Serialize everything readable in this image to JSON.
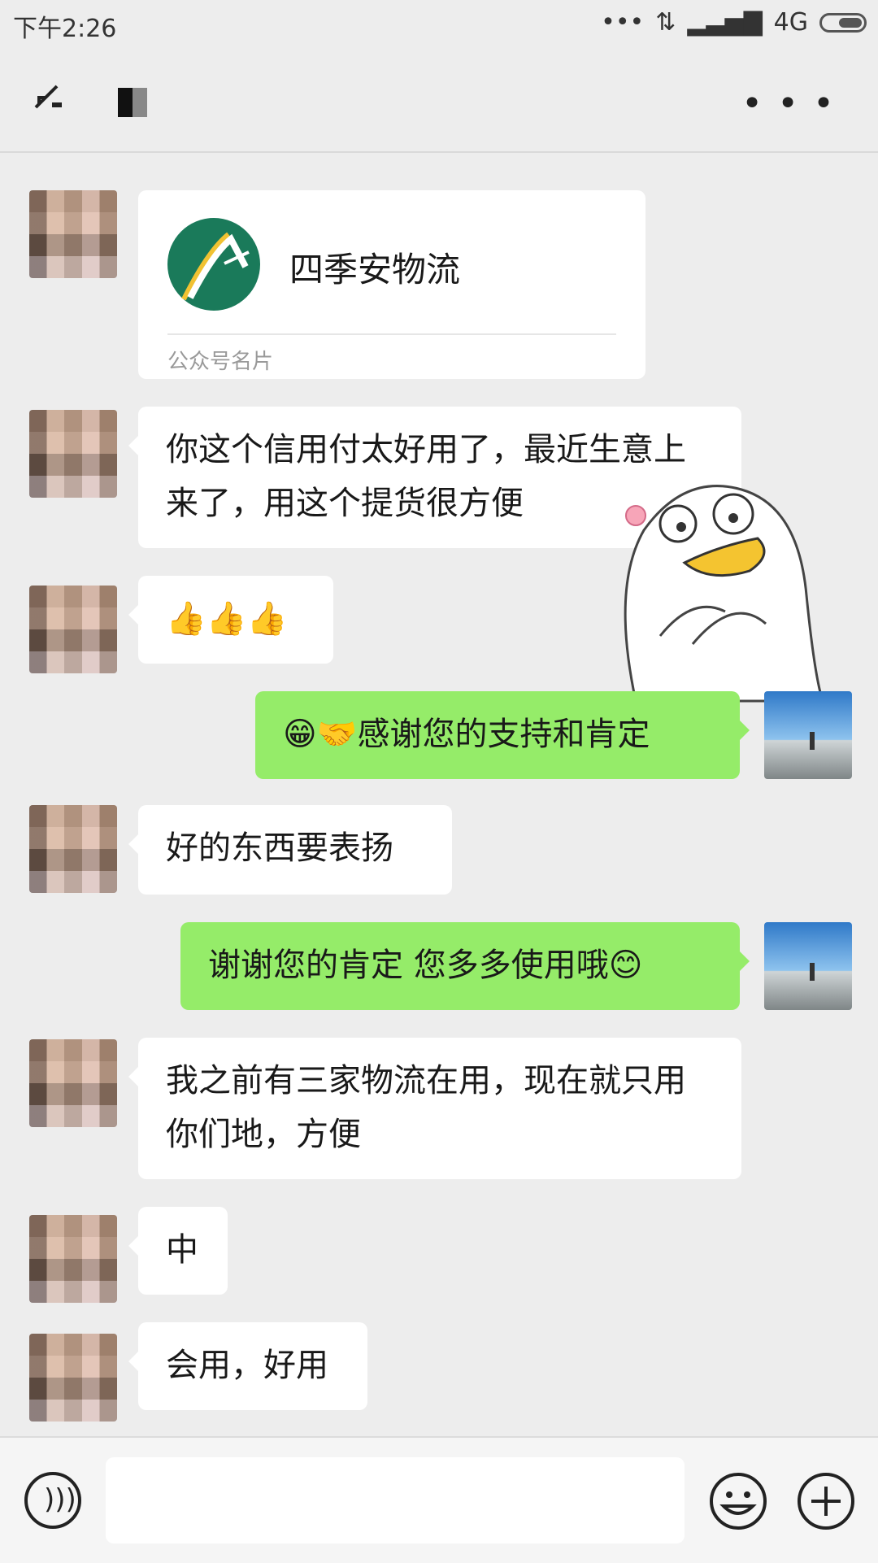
{
  "status": {
    "time": "下午2:26",
    "network": "4G"
  },
  "card": {
    "name": "四季安物流",
    "sub": "公众号名片"
  },
  "messages": {
    "m1": "你这个信用付太好用了，最近生意上来了，用这个提货很方便",
    "m2": "👍👍👍",
    "m3_text": "感谢您的支持和肯定",
    "m3_emoji": "😁🤝",
    "m4": "好的东西要表扬",
    "m5_text": "谢谢您的肯定 您多多使用哦",
    "m5_emoji": "😊",
    "m6": "我之前有三家物流在用，现在就只用你们地，方便",
    "m7": "中",
    "m8": "会用，好用"
  },
  "colors": {
    "bubble_me": "#95ec69",
    "bubble_other": "#ffffff",
    "background": "#ededed"
  },
  "icons": [
    "back-icon",
    "more-icon",
    "voice-icon",
    "emoji-icon",
    "plus-icon"
  ]
}
